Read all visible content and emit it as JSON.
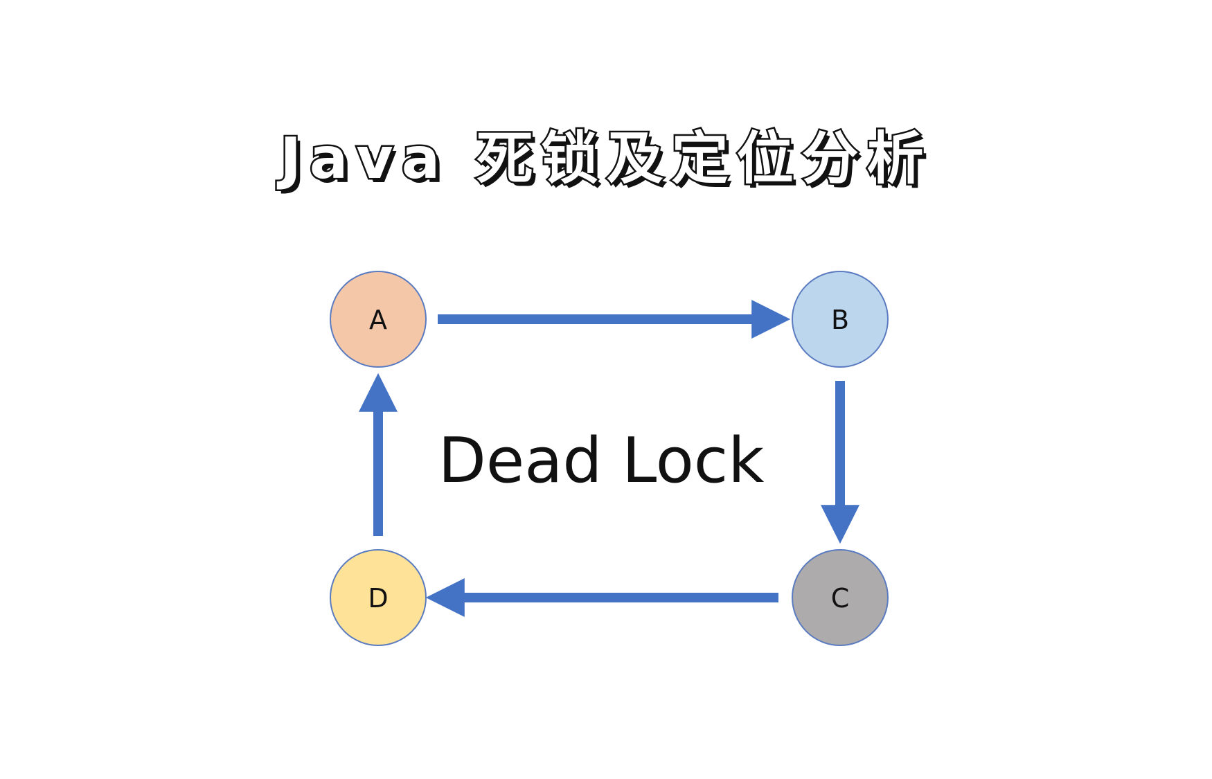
{
  "title": "Java 死锁及定位分析",
  "diagram": {
    "center_label": "Dead Lock",
    "nodes": [
      {
        "id": "A",
        "label": "A",
        "fill": "#f4c7a8"
      },
      {
        "id": "B",
        "label": "B",
        "fill": "#bcd6ee"
      },
      {
        "id": "C",
        "label": "C",
        "fill": "#adabab"
      },
      {
        "id": "D",
        "label": "D",
        "fill": "#fde298"
      }
    ],
    "edges": [
      {
        "from": "A",
        "to": "B"
      },
      {
        "from": "B",
        "to": "C"
      },
      {
        "from": "C",
        "to": "D"
      },
      {
        "from": "D",
        "to": "A"
      }
    ],
    "node_stroke": "#5b7bc0",
    "arrow_color": "#4472c4"
  }
}
